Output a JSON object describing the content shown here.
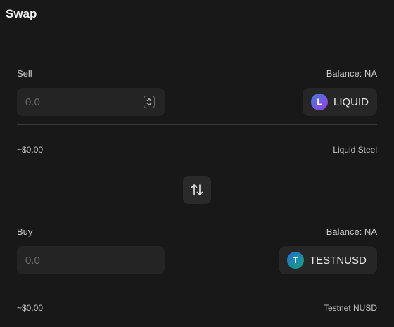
{
  "title": "Swap",
  "sell": {
    "label": "Sell",
    "balance": "Balance: NA",
    "placeholder": "0.0",
    "token": "LIQUID",
    "token_initial": "L",
    "usd_value": "~$0.00",
    "token_name": "Liquid Steel"
  },
  "buy": {
    "label": "Buy",
    "balance": "Balance: NA",
    "placeholder": "0.0",
    "token": "TESTNUSD",
    "token_initial": "T",
    "usd_value": "~$0.00",
    "token_name": "Testnet NUSD"
  },
  "icons": {
    "swap": "swap-direction-icon",
    "stepper": "number-stepper-icon"
  },
  "colors": {
    "background": "#181818",
    "liquid_token": "#7b4fe0",
    "testnusd_token": "#1a8a9a"
  }
}
